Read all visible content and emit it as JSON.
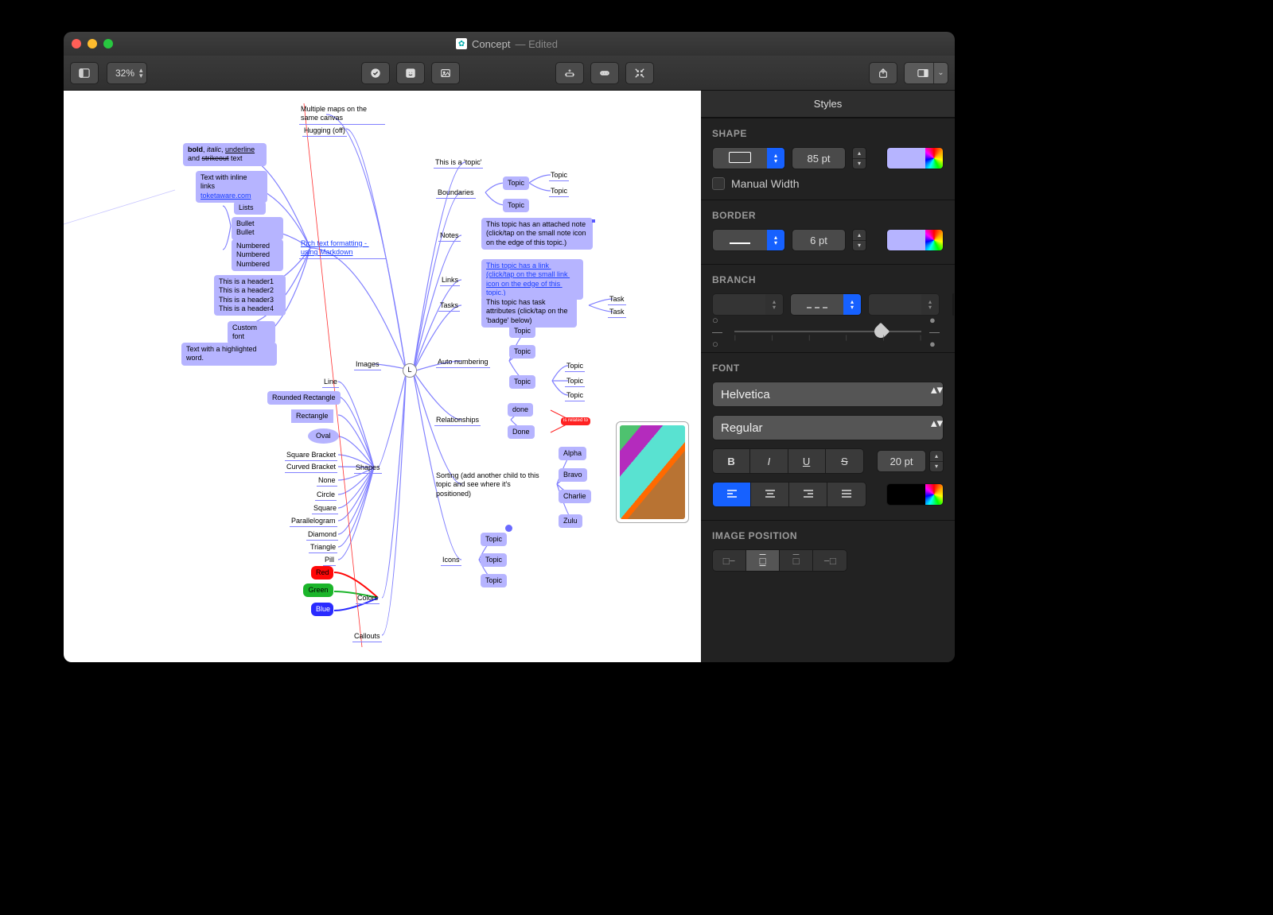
{
  "window": {
    "title_doc": "Concept",
    "title_suffix": "— Edited"
  },
  "toolbar": {
    "zoom": "32%"
  },
  "inspector": {
    "tab": "Styles",
    "sections": {
      "shape": {
        "heading": "SHAPE",
        "width_value": "85 pt",
        "manual_width_label": "Manual Width",
        "manual_width_checked": false,
        "color": "#b6b4ff"
      },
      "border": {
        "heading": "BORDER",
        "width_value": "6 pt",
        "color": "#b6b4ff"
      },
      "branch": {
        "heading": "BRANCH",
        "color": "#b6b4ff",
        "slider_value": 0.78
      },
      "font": {
        "heading": "FONT",
        "family": "Helvetica",
        "weight": "Regular",
        "size": "20 pt",
        "align": "left",
        "text_color": "#000000"
      },
      "image_position": {
        "heading": "IMAGE POSITION"
      }
    }
  },
  "canvas": {
    "center_label": "L",
    "nodes": {
      "multiple_maps": "Multiple maps on the same canvas",
      "hugging": "Hugging (off)",
      "bold_italic": "bold, italic, underline and strikeout text",
      "inline_links": "Text with inline links",
      "inline_links_url": "toketaware.com",
      "lists": "Lists",
      "bullets": "Bullet\nBullet",
      "numbered": "Numbered\nNumbered\nNumbered",
      "headers": "This is a header1\nThis is a header2\nThis is a header3\nThis is a header4",
      "custom_font": "Custom font",
      "highlighted": "Text with a highlighted word.",
      "rich_text": "Rich text formatting - using Markdown",
      "images": "Images",
      "shapes": "Shapes",
      "colors": "Colors",
      "callouts": "Callouts",
      "line": "Line",
      "rounded_rect": "Rounded Rectangle",
      "rectangle": "Rectangle",
      "oval": "Oval",
      "square_bracket": "Square Bracket",
      "curved_bracket": "Curved Bracket",
      "none": "None",
      "circle": "Circle",
      "square": "Square",
      "parallelogram": "Parallelogram",
      "diamond": "Diamond",
      "triangle": "Triangle",
      "pill": "Pill",
      "red": "Red",
      "green": "Green",
      "blue": "Blue",
      "this_is_topic": "This is a 'topic'",
      "boundaries": "Boundaries",
      "notes": "Notes",
      "links": "Links",
      "tasks": "Tasks",
      "auto_numbering": "Auto numbering",
      "relationships": "Relationships",
      "sorting": "Sorting (add another child to this topic and see where it's positioned)",
      "icons": "Icons",
      "topic": "Topic",
      "task": "Task",
      "done_l": "done",
      "done": "Done",
      "alpha": "Alpha",
      "bravo": "Bravo",
      "charlie": "Charlie",
      "zulu": "Zulu",
      "note_attached": "This topic has an attached note (click/tap on the small note icon on the edge of this topic.)",
      "link_attached": "This topic has a link (click/tap on the small link icon on the edge of this topic.)",
      "task_attached": "This topic has task attributes (click/tap on the 'badge' below)",
      "rel_badge": "is related to"
    }
  }
}
